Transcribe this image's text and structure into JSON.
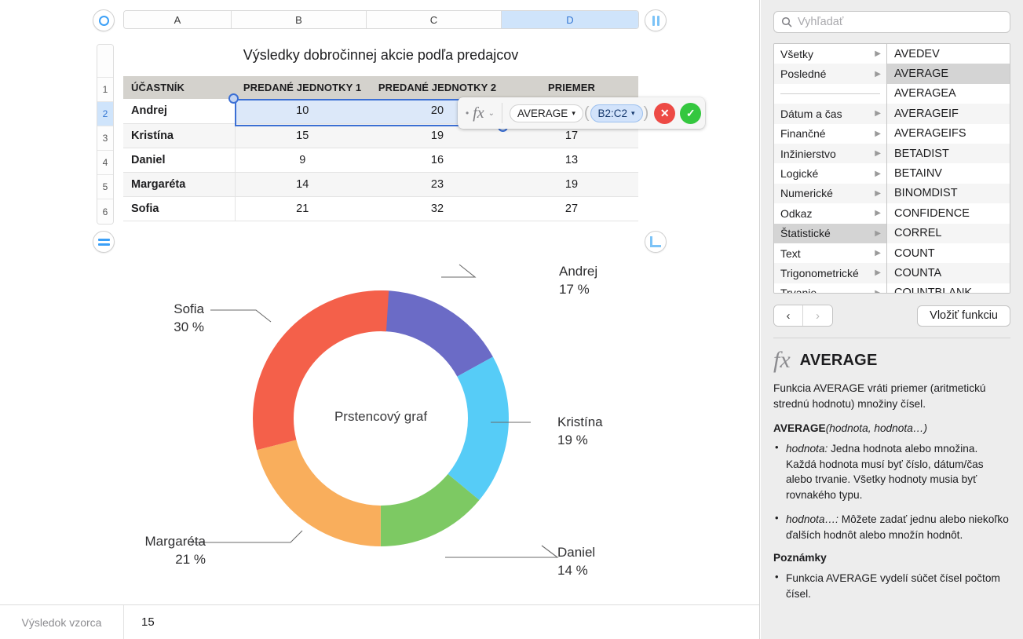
{
  "spreadsheet": {
    "columns": [
      "A",
      "B",
      "C",
      "D"
    ],
    "selected_column": "D",
    "rows": [
      "1",
      "2",
      "3",
      "4",
      "5",
      "6"
    ],
    "selected_row": "2",
    "title": "Výsledky dobročinnej akcie podľa predajcov",
    "headers": [
      "ÚČASTNÍK",
      "PREDANÉ JEDNOTKY 1",
      "PREDANÉ JEDNOTKY 2",
      "PRIEMER"
    ],
    "data": [
      {
        "name": "Andrej",
        "u1": "10",
        "u2": "20",
        "avg": ""
      },
      {
        "name": "Kristína",
        "u1": "15",
        "u2": "19",
        "avg": "17"
      },
      {
        "name": "Daniel",
        "u1": "9",
        "u2": "16",
        "avg": "13"
      },
      {
        "name": "Margaréta",
        "u1": "14",
        "u2": "23",
        "avg": "19"
      },
      {
        "name": "Sofia",
        "u1": "21",
        "u2": "32",
        "avg": "27"
      }
    ]
  },
  "formula_editor": {
    "dot": "•",
    "fx": "fx",
    "chevron": "⌄",
    "function_token": "AVERAGE",
    "function_caret": "▾",
    "range_token": "B2:C2",
    "range_caret": "▾",
    "open_paren": "(",
    "close_paren": ")",
    "cancel_label": "✕",
    "accept_label": "✓"
  },
  "handles": {
    "top_left": "circle-handle",
    "top_right": "columns-handle",
    "bottom_left": "rows-handle",
    "bottom_right": "resize-handle"
  },
  "status_bar": {
    "label": "Výsledok vzorca",
    "value": "15"
  },
  "panel": {
    "search_placeholder": "Vyhľadať",
    "search_value": "",
    "categories": [
      {
        "label": "Všetky",
        "arrow": "▶",
        "active": false
      },
      {
        "label": "Posledné",
        "arrow": "▶",
        "active": false
      },
      {
        "label": "",
        "arrow": "",
        "separator": true
      },
      {
        "label": "Dátum a čas",
        "arrow": "▶",
        "active": false
      },
      {
        "label": "Finančné",
        "arrow": "▶",
        "active": false
      },
      {
        "label": "Inžinierstvo",
        "arrow": "▶",
        "active": false
      },
      {
        "label": "Logické",
        "arrow": "▶",
        "active": false
      },
      {
        "label": "Numerické",
        "arrow": "▶",
        "active": false
      },
      {
        "label": "Odkaz",
        "arrow": "▶",
        "active": false
      },
      {
        "label": "Štatistické",
        "arrow": "▶",
        "active": true
      },
      {
        "label": "Text",
        "arrow": "▶",
        "active": false
      },
      {
        "label": "Trigonometrické",
        "arrow": "▶",
        "active": false
      },
      {
        "label": "Trvanie",
        "arrow": "▶",
        "active": false
      }
    ],
    "functions": [
      {
        "label": "AVEDEV",
        "active": false
      },
      {
        "label": "AVERAGE",
        "active": true
      },
      {
        "label": "AVERAGEA",
        "active": false
      },
      {
        "label": "AVERAGEIF",
        "active": false
      },
      {
        "label": "AVERAGEIFS",
        "active": false
      },
      {
        "label": "BETADIST",
        "active": false
      },
      {
        "label": "BETAINV",
        "active": false
      },
      {
        "label": "BINOMDIST",
        "active": false
      },
      {
        "label": "CONFIDENCE",
        "active": false
      },
      {
        "label": "CORREL",
        "active": false
      },
      {
        "label": "COUNT",
        "active": false
      },
      {
        "label": "COUNTA",
        "active": false
      },
      {
        "label": "COUNTBLANK",
        "active": false
      }
    ],
    "nav_back": "‹",
    "nav_forward": "›",
    "insert_label": "Vložiť funkciu",
    "doc": {
      "fx": "fx",
      "title": "AVERAGE",
      "description": "Funkcia AVERAGE vráti priemer (aritmetickú strednú hodnotu) množiny čísel.",
      "signature_name": "AVERAGE",
      "signature_args": "(hodnota, hodnota…)",
      "bullets": [
        {
          "term": "hodnota:",
          "text": " Jedna hodnota alebo množina. Každá hodnota musí byť číslo, dátum/čas alebo trvanie. Všetky hodnoty musia byť rovnakého typu."
        },
        {
          "term": "hodnota…:",
          "text": " Môžete zadať jednu alebo niekoľko ďalších hodnôt alebo množín hodnôt."
        }
      ],
      "notes_heading": "Poznámky",
      "notes": [
        {
          "term": "",
          "text": "Funkcia AVERAGE vydelí súčet čísel počtom čísel."
        }
      ]
    }
  },
  "chart_data": {
    "type": "pie",
    "title": "Prstencový graf",
    "categories": [
      "Andrej",
      "Kristína",
      "Daniel",
      "Margaréta",
      "Sofia"
    ],
    "values": [
      17,
      19,
      14,
      21,
      30
    ],
    "unit": "%",
    "colors": [
      "#6B6BC6",
      "#56CCF7",
      "#7DC963",
      "#F9AE5C",
      "#F4604A"
    ],
    "labels": [
      {
        "name": "Andrej",
        "pct": "17 %"
      },
      {
        "name": "Kristína",
        "pct": "19 %"
      },
      {
        "name": "Daniel",
        "pct": "14 %"
      },
      {
        "name": "Margaréta",
        "pct": "21 %"
      },
      {
        "name": "Sofia",
        "pct": "30 %"
      }
    ],
    "legend": "none",
    "grid": false
  }
}
